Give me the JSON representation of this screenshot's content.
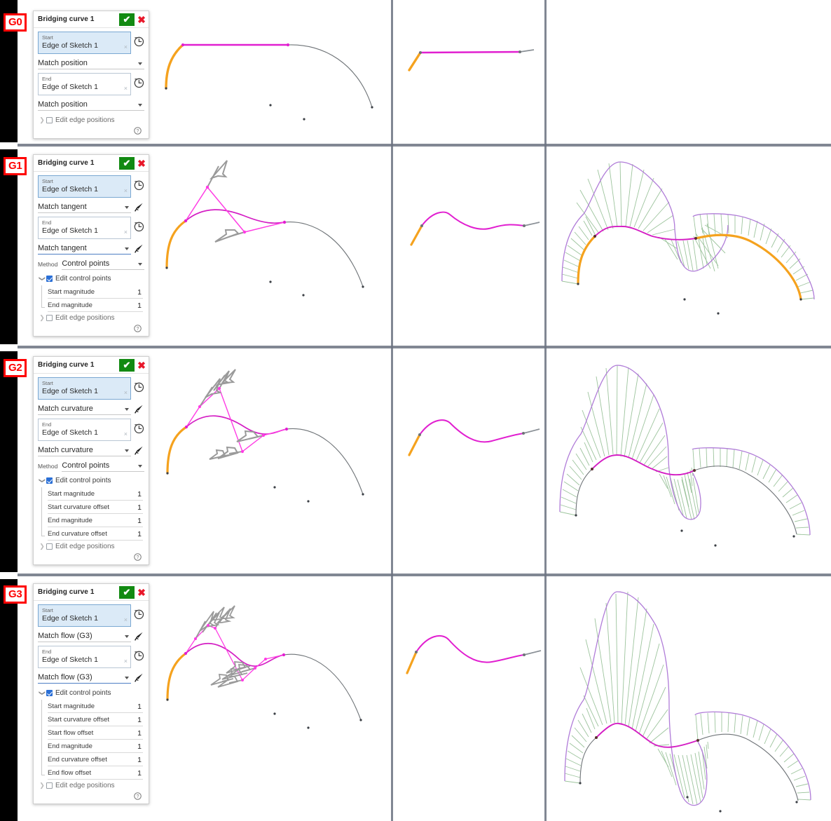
{
  "meta": {
    "accent_green": "#128a12",
    "accent_red": "#e8172a",
    "badge_red": "#ff0000",
    "curve_magenta": "#e11fd0",
    "edge_orange": "#f5a21e",
    "edge_gray": "#6e7377",
    "comb_purple": "#b07cd8",
    "comb_green": "#9dc49d",
    "selection_blue": "#dbeaf7"
  },
  "rows": [
    {
      "badge": "G0",
      "panel": {
        "title": "Bridging curve 1",
        "ok_label": "✔",
        "cancel_label": "✖",
        "start": {
          "label": "Start",
          "value": "Edge of Sketch 1",
          "clear": "×"
        },
        "start_match": "Match position",
        "end": {
          "label": "End",
          "value": "Edge of Sketch 1",
          "clear": "×"
        },
        "end_match": "Match position",
        "method_label": null,
        "method_value": null,
        "edit_control_points": null,
        "params": [],
        "edit_edge_positions": "Edit edge positions",
        "help": "?"
      }
    },
    {
      "badge": "G1",
      "panel": {
        "title": "Bridging curve 1",
        "ok_label": "✔",
        "cancel_label": "✖",
        "start": {
          "label": "Start",
          "value": "Edge of Sketch 1",
          "clear": "×"
        },
        "start_match": "Match tangent",
        "end": {
          "label": "End",
          "value": "Edge of Sketch 1",
          "clear": "×"
        },
        "end_match": "Match tangent",
        "method_label": "Method",
        "method_value": "Control points",
        "edit_control_points": "Edit control points",
        "params": [
          {
            "name": "Start magnitude",
            "value": "1"
          },
          {
            "name": "End magnitude",
            "value": "1"
          }
        ],
        "edit_edge_positions": "Edit edge positions",
        "help": "?"
      }
    },
    {
      "badge": "G2",
      "panel": {
        "title": "Bridging curve 1",
        "ok_label": "✔",
        "cancel_label": "✖",
        "start": {
          "label": "Start",
          "value": "Edge of Sketch 1",
          "clear": "×"
        },
        "start_match": "Match curvature",
        "end": {
          "label": "End",
          "value": "Edge of Sketch 1",
          "clear": "×"
        },
        "end_match": "Match curvature",
        "method_label": "Method",
        "method_value": "Control points",
        "edit_control_points": "Edit control points",
        "params": [
          {
            "name": "Start magnitude",
            "value": "1"
          },
          {
            "name": "Start curvature offset",
            "value": "1"
          },
          {
            "name": "End magnitude",
            "value": "1"
          },
          {
            "name": "End curvature offset",
            "value": "1"
          }
        ],
        "edit_edge_positions": "Edit edge positions",
        "help": "?"
      }
    },
    {
      "badge": "G3",
      "panel": {
        "title": "Bridging curve 1",
        "ok_label": "✔",
        "cancel_label": "✖",
        "start": {
          "label": "Start",
          "value": "Edge of Sketch 1",
          "clear": "×"
        },
        "start_match": "Match flow (G3)",
        "end": {
          "label": "End",
          "value": "Edge of Sketch 1",
          "clear": "×"
        },
        "end_match": "Match flow (G3)",
        "method_label": null,
        "method_value": null,
        "edit_control_points": "Edit control points",
        "params": [
          {
            "name": "Start magnitude",
            "value": "1"
          },
          {
            "name": "Start curvature offset",
            "value": "1"
          },
          {
            "name": "Start flow offset",
            "value": "1"
          },
          {
            "name": "End magnitude",
            "value": "1"
          },
          {
            "name": "End curvature offset",
            "value": "1"
          },
          {
            "name": "End flow offset",
            "value": "1"
          }
        ],
        "edit_edge_positions": "Edit edge positions",
        "help": "?"
      }
    }
  ]
}
